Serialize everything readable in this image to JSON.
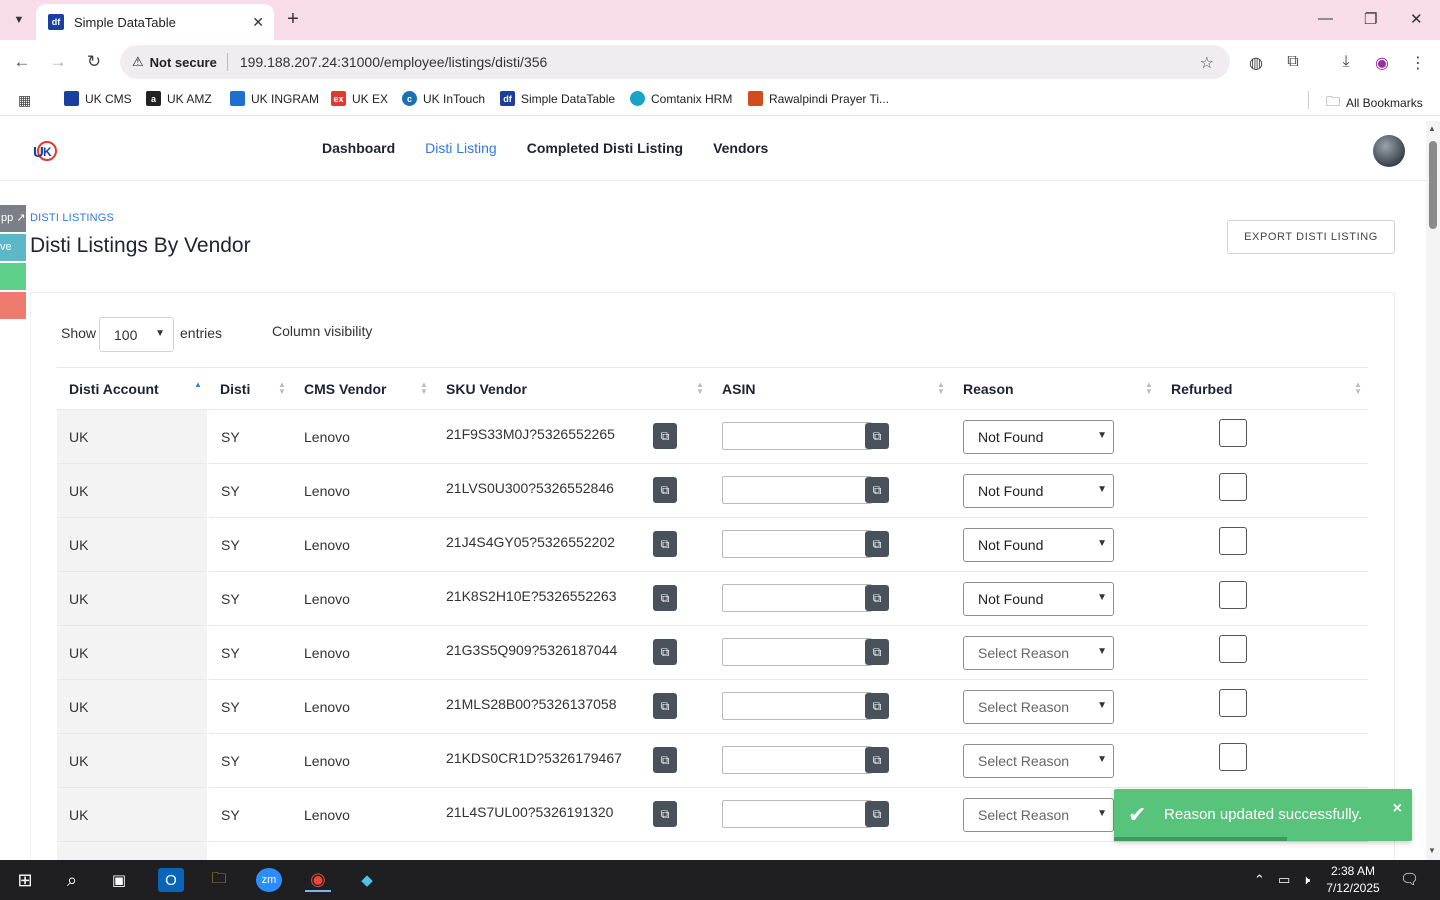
{
  "browser": {
    "tab_title": "Simple DataTable",
    "not_secure": "Not secure",
    "url": "199.188.207.24:31000/employee/listings/disti/356",
    "bookmarks": [
      {
        "label": "UK CMS",
        "color": "#1a3f9e"
      },
      {
        "label": "UK AMZ",
        "color": "#222222"
      },
      {
        "label": "UK INGRAM",
        "color": "#1e6fd0"
      },
      {
        "label": "UK EX",
        "color": "#e23b2e"
      },
      {
        "label": "UK InTouch",
        "color": "#1a6fb5"
      },
      {
        "label": "Simple DataTable",
        "color": "#1a3f9e"
      },
      {
        "label": "Comtanix HRM",
        "color": "#1aa3c9"
      },
      {
        "label": "Rawalpindi Prayer Ti...",
        "color": "#d24b1e"
      }
    ],
    "all_bookmarks": "All Bookmarks"
  },
  "app": {
    "nav": [
      "Dashboard",
      "Disti Listing",
      "Completed Disti Listing",
      "Vendors"
    ],
    "active_nav": "Disti Listing",
    "side_tabs": [
      "pp ↗",
      "ve"
    ],
    "breadcrumb": "DISTI LISTINGS",
    "title": "Disti Listings By Vendor",
    "export_label": "EXPORT DISTI LISTING",
    "show_label": "Show",
    "page_length": "100",
    "entries_label": "entries",
    "column_visibility": "Column visibility",
    "accent_color": "#2c7be5"
  },
  "table": {
    "columns": [
      "Disti Account",
      "Disti",
      "CMS Vendor",
      "SKU Vendor",
      "ASIN",
      "Reason",
      "Refurbed"
    ],
    "sorted_column": "Disti Account",
    "sort_direction": "asc",
    "rows": [
      {
        "account": "UK",
        "disti": "SY",
        "vendor": "Lenovo",
        "sku": "21F9S33M0J?5326552265",
        "asin": "",
        "reason": "Not Found",
        "refurbed": false
      },
      {
        "account": "UK",
        "disti": "SY",
        "vendor": "Lenovo",
        "sku": "21LVS0U300?5326552846",
        "asin": "",
        "reason": "Not Found",
        "refurbed": false
      },
      {
        "account": "UK",
        "disti": "SY",
        "vendor": "Lenovo",
        "sku": "21J4S4GY05?5326552202",
        "asin": "",
        "reason": "Not Found",
        "refurbed": false
      },
      {
        "account": "UK",
        "disti": "SY",
        "vendor": "Lenovo",
        "sku": "21K8S2H10E?5326552263",
        "asin": "",
        "reason": "Not Found",
        "refurbed": false
      },
      {
        "account": "UK",
        "disti": "SY",
        "vendor": "Lenovo",
        "sku": "21G3S5Q909?5326187044",
        "asin": "",
        "reason": "Select Reason",
        "refurbed": false
      },
      {
        "account": "UK",
        "disti": "SY",
        "vendor": "Lenovo",
        "sku": "21MLS28B00?5326137058",
        "asin": "",
        "reason": "Select Reason",
        "refurbed": false
      },
      {
        "account": "UK",
        "disti": "SY",
        "vendor": "Lenovo",
        "sku": "21KDS0CR1D?5326179467",
        "asin": "",
        "reason": "Select Reason",
        "refurbed": false
      },
      {
        "account": "UK",
        "disti": "SY",
        "vendor": "Lenovo",
        "sku": "21L4S7UL00?5326191320",
        "asin": "",
        "reason": "Select Reason",
        "refurbed": false
      }
    ]
  },
  "toast": {
    "message": "Reason updated successfully.",
    "close": "×",
    "progress": 0.58
  },
  "taskbar": {
    "time": "2:38 AM",
    "date": "7/12/2025",
    "notifications": "1"
  }
}
